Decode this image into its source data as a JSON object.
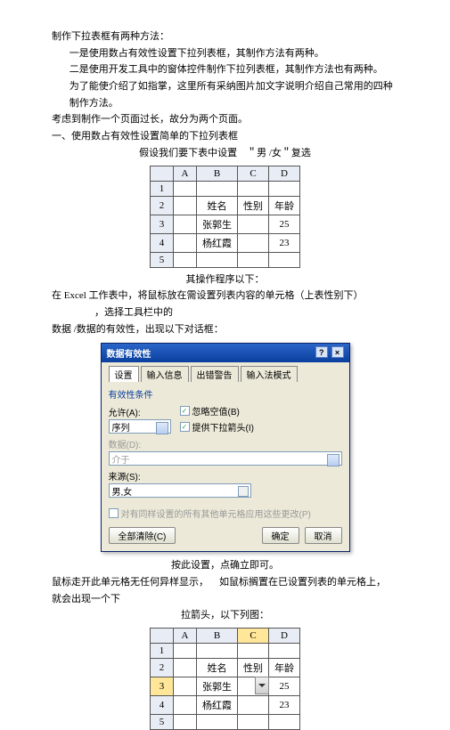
{
  "intro": {
    "p1": "制作下拉表框有两种方法：",
    "p2": "一是使用数占有效性设置下拉列表框，其制作方法有两种。",
    "p3": "二是使用开发工具中的窗体控件制作下拉列表框，其制作方法也有两种。",
    "p4": "为了能使介绍了如指掌，这里所有采纳图片加文字说明介绍自己常用的四种制作方法。",
    "p5": "考虑到制作一个页面过长，故分为两个页面。",
    "h1": "一、使用数占有效性设置简单的下拉列表框",
    "sub1": "假设我们要下表中设置　＂男 /女＂复选"
  },
  "table1": {
    "cols": [
      "",
      "A",
      "B",
      "C",
      "D"
    ],
    "rows": [
      [
        "1",
        "",
        "",
        "",
        ""
      ],
      [
        "2",
        "",
        "姓名",
        "性别",
        "年龄"
      ],
      [
        "3",
        "",
        "张郭生",
        "",
        "25"
      ],
      [
        "4",
        "",
        "杨红霞",
        "",
        "23"
      ],
      [
        "5",
        "",
        "",
        "",
        ""
      ]
    ]
  },
  "mid1": "其操作程序以下：",
  "mid2_a": "在 Excel 工作表中，将鼠标放在需设置列表内容的单元格（上表性别下）",
  "mid2_b": "，选择工具栏中的",
  "mid3": "数据 /数据的有效性，出现以下对话框：",
  "dialog": {
    "title": "数据有效性",
    "help": "?",
    "close": "×",
    "tabs": [
      "设置",
      "输入信息",
      "出错警告",
      "输入法模式"
    ],
    "group": "有效性条件",
    "allow_label": "允许(A):",
    "allow_value": "序列",
    "chk_blank": "忽略空值(B)",
    "chk_dropdown": "提供下拉箭头(I)",
    "data_label": "数据(D):",
    "data_value": "介于",
    "source_label": "来源(S):",
    "source_value": "男,女",
    "apply_chk": "对有同样设置的所有其他单元格应用这些更改(P)",
    "clear": "全部清除(C)",
    "ok": "确定",
    "cancel": "取消"
  },
  "mid4": "按此设置，点确立即可。",
  "mid5_a": "鼠标走开此单元格无任何异样显示，",
  "mid5_b": "如鼠标搁置在已设置列表的单元格上，",
  "mid5_c": "就会出现一个下",
  "mid6": "拉箭头，以下列图：",
  "table2": {
    "cols": [
      "",
      "A",
      "B",
      "C",
      "D"
    ],
    "rows": [
      [
        "1",
        "",
        "",
        "",
        ""
      ],
      [
        "2",
        "",
        "姓名",
        "性别",
        "年龄"
      ],
      [
        "3",
        "",
        "张郭生",
        "",
        "25"
      ],
      [
        "4",
        "",
        "杨红霞",
        "",
        "23"
      ],
      [
        "5",
        "",
        "",
        "",
        ""
      ]
    ]
  }
}
